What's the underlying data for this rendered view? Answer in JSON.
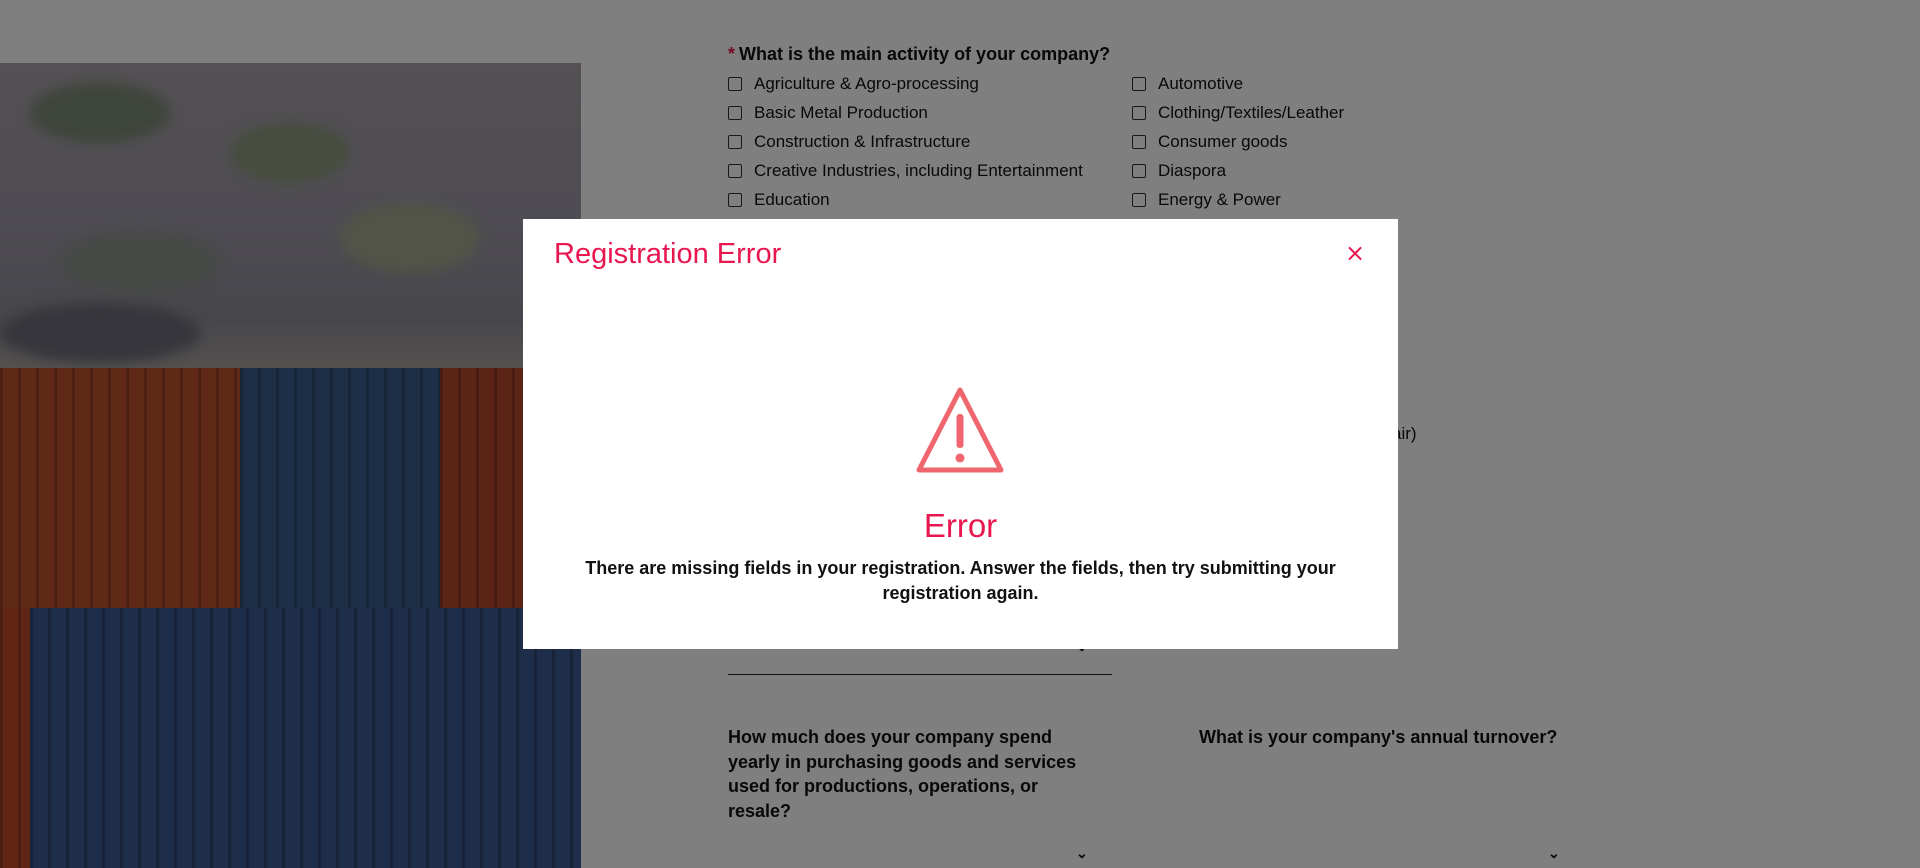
{
  "form": {
    "required_marker": "*",
    "main_activity_question": "What is the main activity of your company?",
    "activities": [
      "Agriculture & Agro-processing",
      "Automotive",
      "Basic Metal Production",
      "Clothing/Textiles/Leather",
      "Construction & Infrastructure",
      "Consumer goods",
      "Creative Industries, including Entertainment",
      "Diaspora",
      "Education",
      "Energy & Power"
    ],
    "partial_option_text": "air)",
    "spend_question": "How much does your company spend yearly in purchasing goods and services used for productions, operations, or resale?",
    "turnover_question": "What is your company's annual turnover?",
    "chevron": "⌄"
  },
  "modal": {
    "title": "Registration Error",
    "close_symbol": "×",
    "icon": "warning-triangle-icon",
    "error_heading": "Error",
    "error_message": "There are missing fields in your registration. Answer the fields, then try submitting your registration again."
  },
  "colors": {
    "accent": "#e8174f",
    "warning_icon": "#f0666e",
    "overlay": "rgba(0,0,0,0.5)"
  }
}
